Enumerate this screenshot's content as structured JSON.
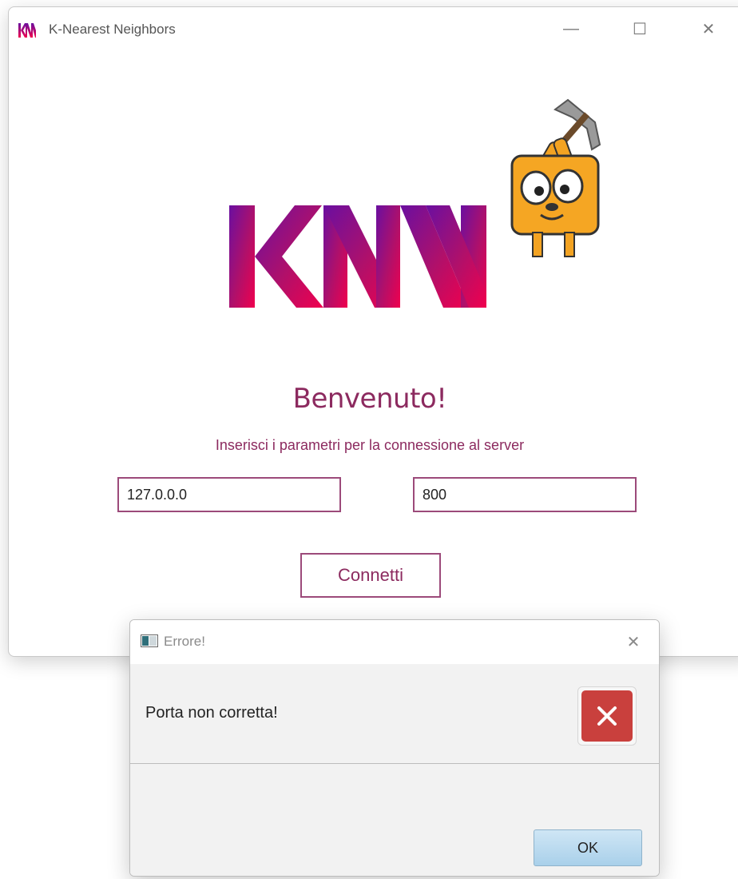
{
  "main_window": {
    "title": "K-Nearest Neighbors",
    "minimize_label": "—",
    "maximize_label": "☐",
    "close_label": "✕",
    "logo_text": "KNN",
    "welcome": "Benvenuto!",
    "subtitle": "Inserisci i parametri per la connessione al server",
    "host_value": "127.0.0.0",
    "port_value": "800",
    "connect_label": "Connetti"
  },
  "dialog": {
    "title": "Errore!",
    "close_label": "✕",
    "message": "Porta non corretta!",
    "ok_label": "OK"
  },
  "colors": {
    "accent": "#8c2a5f",
    "logo_top": "#6a0fa0",
    "logo_bottom": "#f0004e",
    "error_red": "#c9403d"
  }
}
